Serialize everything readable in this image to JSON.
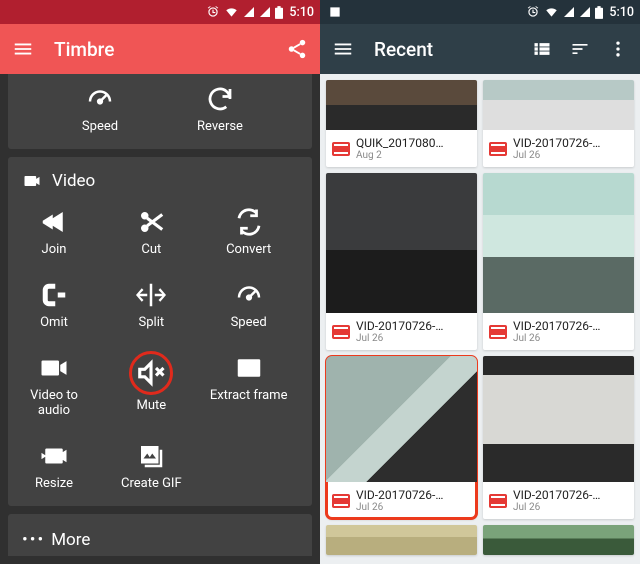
{
  "status": {
    "time": "5:10"
  },
  "left": {
    "title": "Timbre",
    "top_tools": [
      {
        "name": "Speed"
      },
      {
        "name": "Reverse"
      }
    ],
    "video_section": "Video",
    "video_tools": [
      {
        "name": "Join"
      },
      {
        "name": "Cut"
      },
      {
        "name": "Convert"
      },
      {
        "name": "Omit"
      },
      {
        "name": "Split"
      },
      {
        "name": "Speed"
      },
      {
        "name": "Video to audio"
      },
      {
        "name": "Mute",
        "highlighted": true
      },
      {
        "name": "Extract frame"
      },
      {
        "name": "Resize"
      },
      {
        "name": "Create GIF"
      }
    ],
    "more": "More"
  },
  "right": {
    "title": "Recent",
    "videos": [
      {
        "name": "QUIK_2017080…",
        "date": "Aug 2",
        "thumb_h": 50,
        "thumb_class": "th-a"
      },
      {
        "name": "VID-20170726-…",
        "date": "Jul 26",
        "thumb_h": 50,
        "thumb_class": "th-b"
      },
      {
        "name": "VID-20170726-…",
        "date": "Jul 26",
        "thumb_h": 140,
        "thumb_class": "th-c"
      },
      {
        "name": "VID-20170726-…",
        "date": "Jul 26",
        "thumb_h": 140,
        "thumb_class": "th-d"
      },
      {
        "name": "VID-20170726-…",
        "date": "Jul 26",
        "thumb_h": 126,
        "thumb_class": "th-e",
        "selected": true
      },
      {
        "name": "VID-20170726-…",
        "date": "Jul 26",
        "thumb_h": 126,
        "thumb_class": "th-f"
      },
      {
        "name": "",
        "date": "",
        "thumb_h": 30,
        "thumb_class": "th-g",
        "partial": true
      },
      {
        "name": "",
        "date": "",
        "thumb_h": 30,
        "thumb_class": "th-h",
        "partial": true
      }
    ]
  }
}
